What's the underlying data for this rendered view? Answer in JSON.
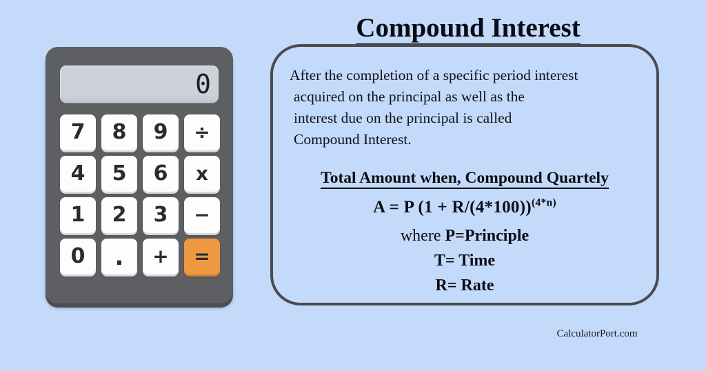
{
  "page": {
    "background_color": "#c3dafb",
    "title": "Compound Interest",
    "footer": "CalculatorPort.com"
  },
  "calculator": {
    "body_color": "#5d5f63",
    "display": {
      "value": "0",
      "background_color": "#ccd1da"
    },
    "accent_color": "#f09841",
    "keys": [
      {
        "label": "7",
        "name": "key-7",
        "type": "digit"
      },
      {
        "label": "8",
        "name": "key-8",
        "type": "digit"
      },
      {
        "label": "9",
        "name": "key-9",
        "type": "digit"
      },
      {
        "label": "÷",
        "name": "key-divide",
        "type": "operator"
      },
      {
        "label": "4",
        "name": "key-4",
        "type": "digit"
      },
      {
        "label": "5",
        "name": "key-5",
        "type": "digit"
      },
      {
        "label": "6",
        "name": "key-6",
        "type": "digit"
      },
      {
        "label": "x",
        "name": "key-multiply",
        "type": "operator"
      },
      {
        "label": "1",
        "name": "key-1",
        "type": "digit"
      },
      {
        "label": "2",
        "name": "key-2",
        "type": "digit"
      },
      {
        "label": "3",
        "name": "key-3",
        "type": "digit"
      },
      {
        "label": "−",
        "name": "key-minus",
        "type": "operator"
      },
      {
        "label": "0",
        "name": "key-0",
        "type": "digit"
      },
      {
        "label": ".",
        "name": "key-decimal",
        "type": "decimal"
      },
      {
        "label": "+",
        "name": "key-plus",
        "type": "operator"
      },
      {
        "label": "=",
        "name": "key-equals",
        "type": "equals"
      }
    ]
  },
  "info_box": {
    "border_color": "#4b4b4f",
    "definition_lines": [
      "After the completion of a specific period interest",
      "acquired on the principal as well as the",
      "interest due on the principal is called",
      "Compound Interest."
    ],
    "subheading": "Total Amount when, Compound Quartely",
    "formula": {
      "base": "A = P (1 + R/(4*100))",
      "exponent": "(4*n)"
    },
    "where": [
      {
        "label": "where ",
        "value": "P=Principle"
      },
      {
        "label": "",
        "value": "T= Time"
      },
      {
        "label": "",
        "value": "R= Rate"
      }
    ]
  }
}
